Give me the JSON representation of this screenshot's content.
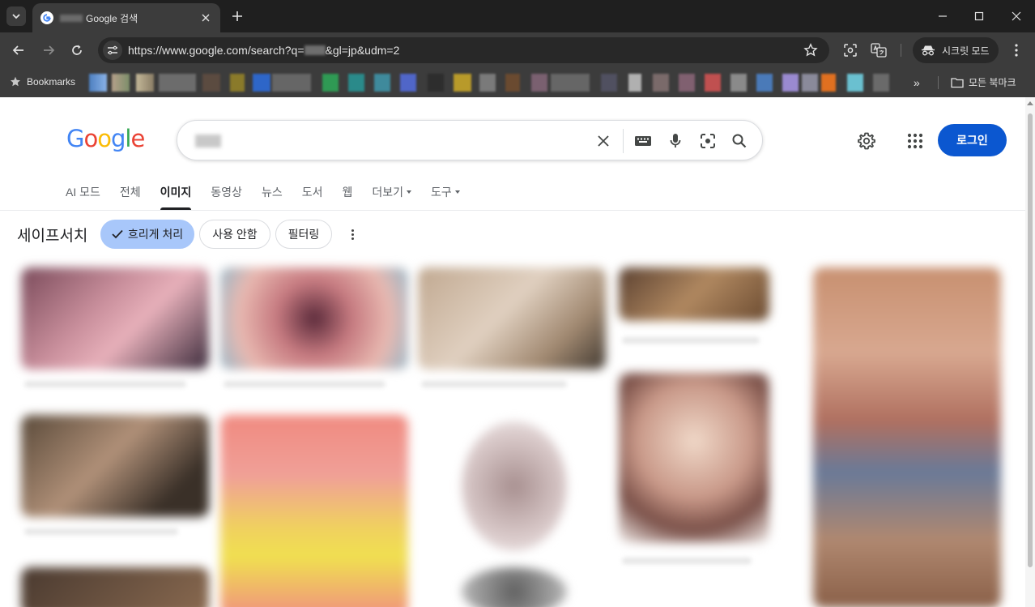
{
  "browser": {
    "tab_title": "Google 검색",
    "url_prefix": "https://www.google.com/search?q=",
    "url_suffix": "&gl=jp&udm=2",
    "incognito_label": "시크릿 모드",
    "bookmarks_label": "Bookmarks",
    "all_bookmarks_label": "모든 북마크",
    "more_bookmarks_label": "»"
  },
  "google": {
    "logo_letters": [
      "G",
      "o",
      "o",
      "g",
      "l",
      "e"
    ],
    "logo_colors": [
      "#4285f4",
      "#ea4335",
      "#fbbc05",
      "#4285f4",
      "#34a853",
      "#ea4335"
    ],
    "signin_label": "로그인",
    "tabs": [
      {
        "label": "AI 모드"
      },
      {
        "label": "전체"
      },
      {
        "label": "이미지"
      },
      {
        "label": "동영상"
      },
      {
        "label": "뉴스"
      },
      {
        "label": "도서"
      },
      {
        "label": "웹"
      },
      {
        "label": "더보기"
      },
      {
        "label": "도구"
      }
    ],
    "active_tab": "이미지",
    "safesearch": {
      "label": "세이프서치",
      "options": [
        "흐리게 처리",
        "사용 안함",
        "필터링"
      ],
      "selected": "흐리게 처리"
    }
  },
  "colors": {
    "accent": "#0b57d0",
    "chip_selected": "#a8c7fa",
    "chrome_dark": "#1f1f1f",
    "chrome_mid": "#3c3c3c"
  }
}
